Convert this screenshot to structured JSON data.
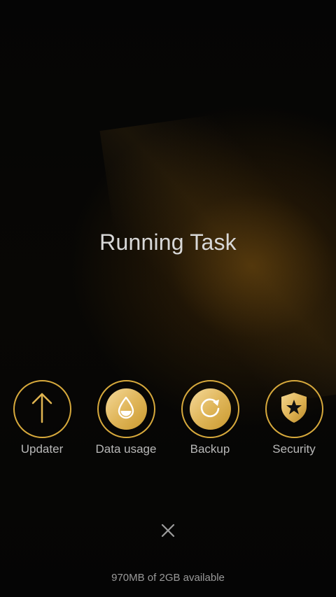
{
  "panel": {
    "title": "Running Task",
    "accent_color": "#d7a93c"
  },
  "tiles": [
    {
      "label": "Updater",
      "icon": "arrow-up-icon"
    },
    {
      "label": "Data usage",
      "icon": "water-drop-icon"
    },
    {
      "label": "Backup",
      "icon": "refresh-icon"
    },
    {
      "label": "Security",
      "icon": "shield-star-icon"
    }
  ],
  "close": {
    "icon": "close-icon"
  },
  "footer": {
    "storage": "970MB of 2GB available"
  }
}
